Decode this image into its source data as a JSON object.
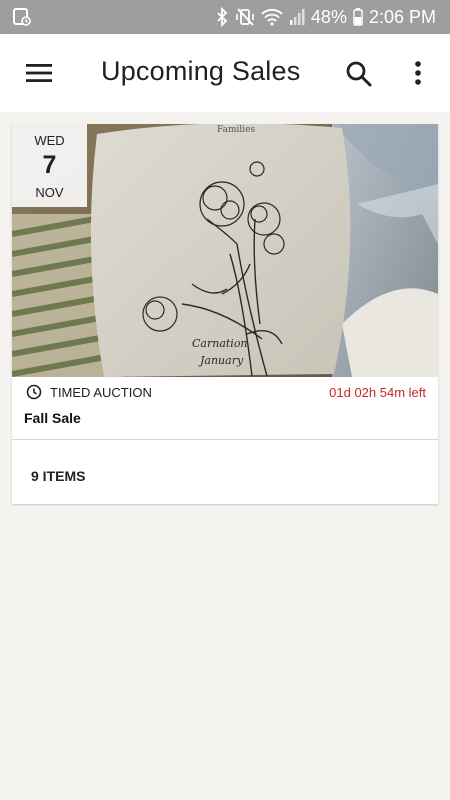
{
  "status_bar": {
    "battery_percent": "48%",
    "time": "2:06 PM",
    "icons": [
      "screenshot-notification-icon",
      "bluetooth-icon",
      "vibrate-mute-icon",
      "wifi-icon",
      "signal-icon",
      "battery-icon"
    ]
  },
  "app_bar": {
    "title": "Upcoming Sales",
    "icons": [
      "menu-icon",
      "search-icon",
      "more-vert-icon"
    ]
  },
  "sale_card": {
    "date": {
      "day_of_week": "WED",
      "day": "7",
      "month": "NOV"
    },
    "sale_type": "TIMED AUCTION",
    "time_left": "01d 02h 54m left",
    "name": "Fall Sale",
    "items_label": "9 ITEMS",
    "image_icon": "floral-pillow-photo",
    "colors": {
      "time_left": "#c62828"
    }
  }
}
